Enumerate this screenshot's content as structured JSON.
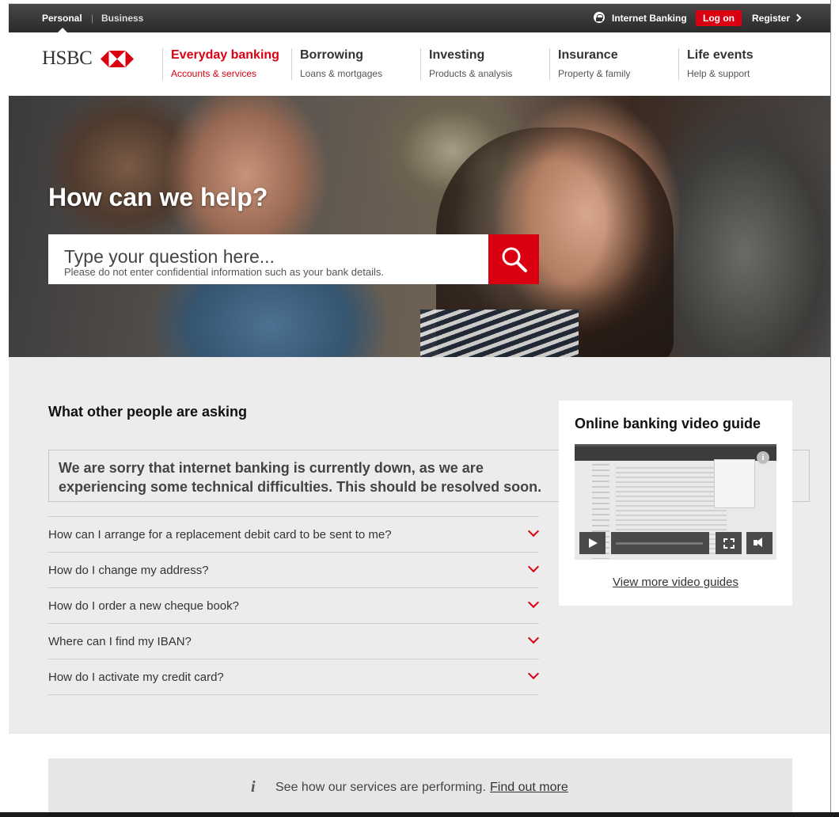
{
  "topbar": {
    "segments": [
      "Personal",
      "Business"
    ],
    "internet_banking": "Internet Banking",
    "logon": "Log on",
    "register": "Register"
  },
  "brand": {
    "logo_text": "HSBC",
    "accent": "#db0011"
  },
  "nav": [
    {
      "title": "Everyday banking",
      "sub": "Accounts & services",
      "active": true
    },
    {
      "title": "Borrowing",
      "sub": "Loans & mortgages"
    },
    {
      "title": "Investing",
      "sub": "Products & analysis"
    },
    {
      "title": "Insurance",
      "sub": "Property & family"
    },
    {
      "title": "Life events",
      "sub": "Help & support"
    }
  ],
  "hero": {
    "title": "How can we help?",
    "search_placeholder": "Type your question here...",
    "search_hint": "Please do not enter confidential information such as your bank details."
  },
  "asking": {
    "title": "What other people are asking",
    "notice": "We are sorry that internet banking is currently down, as we are experiencing some technical difficulties. This should be resolved soon.",
    "questions": [
      "How can I arrange for a replacement debit card to be sent to me?",
      "How do I change my address?",
      "How do I order a new cheque book?",
      "Where can I find my IBAN?",
      "How do I activate my credit card?"
    ]
  },
  "video": {
    "title": "Online banking video guide",
    "link": "View more video guides",
    "info_glyph": "i"
  },
  "status": {
    "icon": "info-icon",
    "text": "See how our services are performing.",
    "link": "Find out more"
  }
}
